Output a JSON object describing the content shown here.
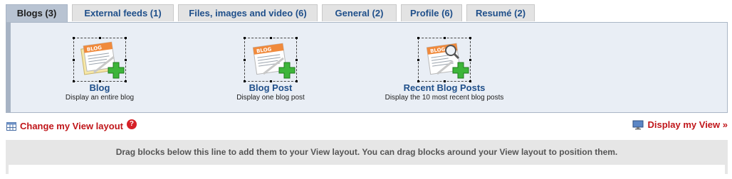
{
  "tabs": [
    {
      "label": "Blogs (3)"
    },
    {
      "label": "External feeds (1)"
    },
    {
      "label": "Files, images and video (6)"
    },
    {
      "label": "General (2)"
    },
    {
      "label": "Profile (6)"
    },
    {
      "label": "Resumé (2)"
    }
  ],
  "blocks": [
    {
      "title": "Blog",
      "desc": "Display an entire blog"
    },
    {
      "title": "Blog Post",
      "desc": "Display one blog post"
    },
    {
      "title": "Recent Blog Posts",
      "desc": "Display the 10 most recent blog posts"
    }
  ],
  "links": {
    "change_layout": "Change my View layout",
    "help": "?",
    "display_view": "Display my View »"
  },
  "drop_area": {
    "instruction": "Drag blocks below this line to add them to your View layout. You can drag blocks around your View layout to position them."
  },
  "colors": {
    "accent_blue": "#1f4f8a",
    "link_red": "#c0161a",
    "active_tab": "#b8c3d2",
    "panel_bg": "#e9eef5"
  },
  "icons": [
    "blog-notepad-icon",
    "add-plus-icon",
    "magnifier-icon",
    "table-layout-icon",
    "help-icon",
    "monitor-icon"
  ]
}
